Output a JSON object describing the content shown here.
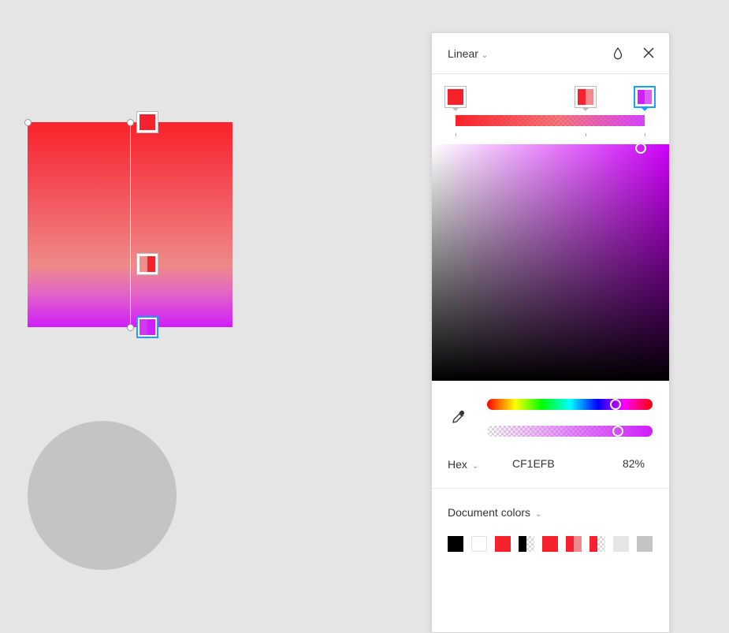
{
  "canvas": {
    "gradient_stops": [
      {
        "name": "top-stop",
        "swatch": [
          "#f5222d"
        ],
        "selected": false
      },
      {
        "name": "middle-stop",
        "swatch": [
          "#ef8e8c",
          "#f5222d"
        ],
        "selected": false
      },
      {
        "name": "bottom-stop",
        "swatch": [
          "#d236f0",
          "#cf1efb"
        ],
        "selected": true
      }
    ]
  },
  "panel": {
    "gradient_type": "Linear",
    "icons": {
      "opacity": "drop-icon",
      "close": "close-icon",
      "eyedropper": "eyedropper-icon"
    },
    "stops": [
      {
        "swatch": [
          "#f5222d"
        ],
        "selected": false
      },
      {
        "swatch": [
          "#f5222d",
          "#f38a8d"
        ],
        "selected": false
      },
      {
        "swatch": [
          "#cf1efb",
          "#d85ff0"
        ],
        "selected": true
      }
    ],
    "color_format": "Hex",
    "hex_value": "CF1EFB",
    "opacity_value": "82%",
    "hue_position": 0.78,
    "alpha_position": 0.82,
    "document_colors_label": "Document colors",
    "document_colors": [
      {
        "colors": [
          "#000000"
        ]
      },
      {
        "colors": [
          "#ffffff"
        ],
        "border": true
      },
      {
        "colors": [
          "#f5222d"
        ]
      },
      {
        "colors": [
          "#000000",
          "checker"
        ]
      },
      {
        "colors": [
          "#f5222d"
        ]
      },
      {
        "colors": [
          "#f5222d",
          "#f08a8d"
        ]
      },
      {
        "colors": [
          "#f5222d",
          "checker"
        ]
      },
      {
        "colors": [
          "#e5e5e5"
        ]
      },
      {
        "colors": [
          "#c4c4c4"
        ]
      }
    ]
  }
}
